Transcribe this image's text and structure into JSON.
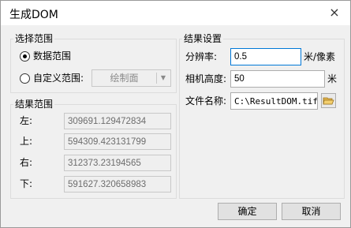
{
  "window": {
    "title": "生成DOM",
    "close_icon": "×"
  },
  "selection_range": {
    "legend": "选择范围",
    "options": [
      {
        "label": "数据范围",
        "checked": true
      },
      {
        "label": "自定义范围:",
        "checked": false
      }
    ],
    "draw_face_label": "绘制面"
  },
  "result_range": {
    "legend": "结果范围",
    "rows": [
      {
        "label": "左:",
        "value": "309691.129472834"
      },
      {
        "label": "上:",
        "value": "594309.423131799"
      },
      {
        "label": "右:",
        "value": "312373.23194565"
      },
      {
        "label": "下:",
        "value": "591627.320658983"
      }
    ]
  },
  "result_settings": {
    "legend": "结果设置",
    "resolution": {
      "label": "分辨率:",
      "value": "0.5",
      "unit": "米/像素"
    },
    "camera_height": {
      "label": "相机高度:",
      "value": "50",
      "unit": "米"
    },
    "file_name": {
      "label": "文件名称:",
      "value": "C:\\ResultDOM.tiff"
    }
  },
  "buttons": {
    "ok": "确定",
    "cancel": "取消"
  },
  "colors": {
    "focus_border": "#0078d7",
    "folder_icon": "#e0b24a"
  }
}
